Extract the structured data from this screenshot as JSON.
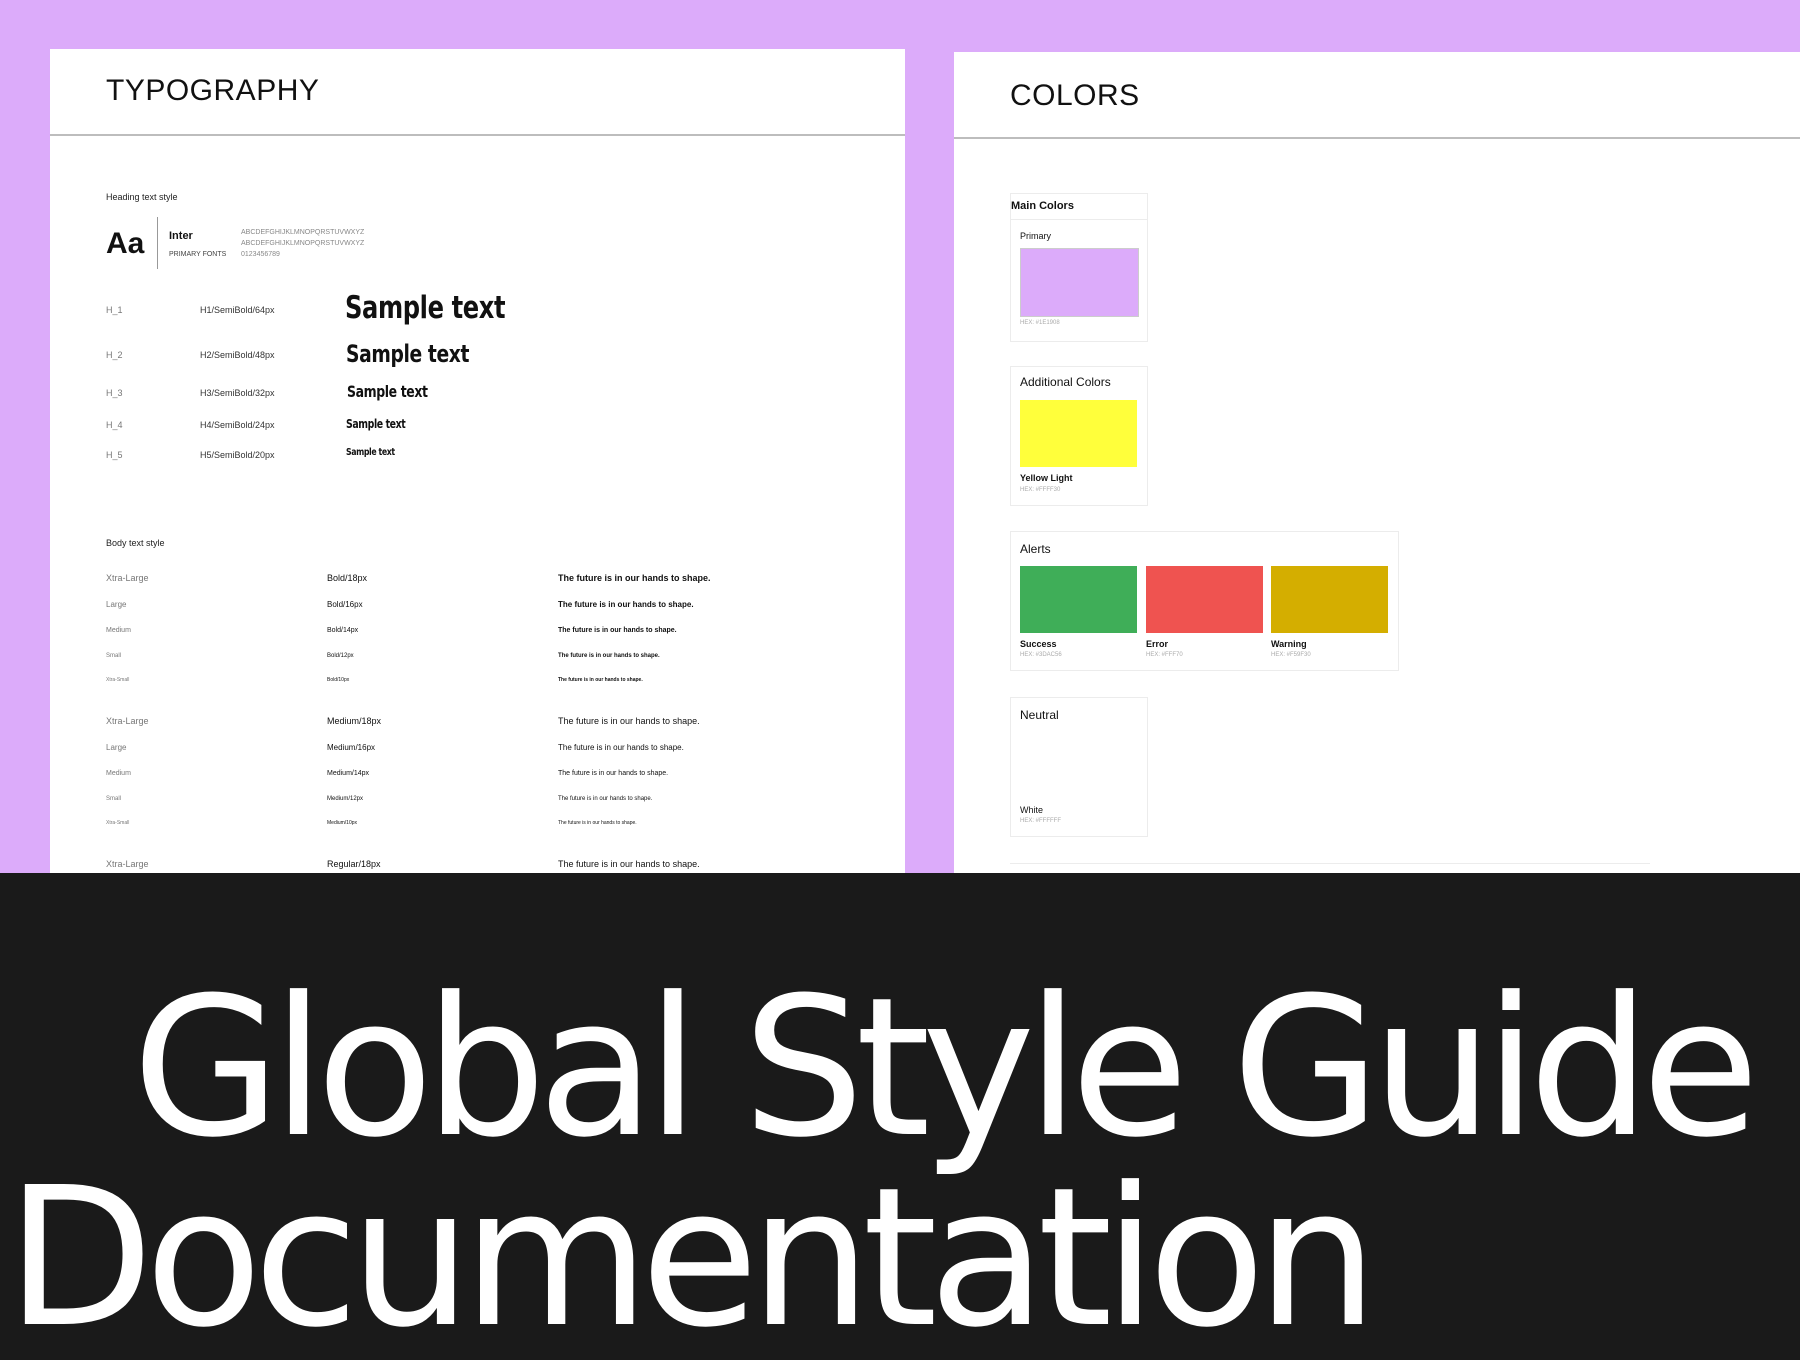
{
  "typography": {
    "title": "TYPOGRAPHY",
    "heading_section": "Heading text style",
    "font_preview": "Aa",
    "font_name": "Inter",
    "font_role": "PRIMARY FONTS",
    "charset_upper": "ABCDEFGHIJKLMNOPQRSTUVWXYZ",
    "charset_lower": "ABCDEFGHIJKLMNOPQRSTUVWXYZ",
    "charset_digits": "0123456789",
    "headings": [
      {
        "label": "H_1",
        "spec": "H1/SemiBold/64px",
        "sample": "Sample text"
      },
      {
        "label": "H_2",
        "spec": "H2/SemiBold/48px",
        "sample": "Sample text"
      },
      {
        "label": "H_3",
        "spec": "H3/SemiBold/32px",
        "sample": "Sample text"
      },
      {
        "label": "H_4",
        "spec": "H4/SemiBold/24px",
        "sample": "Sample text"
      },
      {
        "label": "H_5",
        "spec": "H5/SemiBold/20px",
        "sample": "Sample text"
      }
    ],
    "body_section": "Body text style",
    "body_groups": [
      [
        {
          "size": "Xtra-Large",
          "spec": "Bold/18px",
          "sample": "The future is in our hands to shape."
        },
        {
          "size": "Large",
          "spec": "Bold/16px",
          "sample": "The future is in our hands to shape."
        },
        {
          "size": "Medium",
          "spec": "Bold/14px",
          "sample": "The future is in our hands to shape."
        },
        {
          "size": "Small",
          "spec": "Bold/12px",
          "sample": "The future is in our hands to shape."
        },
        {
          "size": "Xtra-Small",
          "spec": "Bold/10px",
          "sample": "The future is in our hands to shape."
        }
      ],
      [
        {
          "size": "Xtra-Large",
          "spec": "Medium/18px",
          "sample": "The future is in our hands to shape."
        },
        {
          "size": "Large",
          "spec": "Medium/16px",
          "sample": "The future is in our hands to shape."
        },
        {
          "size": "Medium",
          "spec": "Medium/14px",
          "sample": "The future is in our hands to shape."
        },
        {
          "size": "Small",
          "spec": "Medium/12px",
          "sample": "The future is in our hands to shape."
        },
        {
          "size": "Xtra-Small",
          "spec": "Medium/10px",
          "sample": "The future is in our hands to shape."
        }
      ],
      [
        {
          "size": "Xtra-Large",
          "spec": "Regular/18px",
          "sample": "The future is in our hands to shape."
        }
      ]
    ]
  },
  "colors": {
    "title": "COLORS",
    "main": {
      "title": "Main Colors",
      "name": "Primary",
      "hex": "HEX: #1E1908",
      "color": "#dcabfa"
    },
    "additional": {
      "title": "Additional Colors",
      "name": "Yellow Light",
      "hex": "HEX: #FFFF30",
      "color": "#ffff3b"
    },
    "alerts": {
      "title": "Alerts",
      "items": [
        {
          "name": "Success",
          "hex": "HEX: #3DAC56",
          "color": "#3fae58"
        },
        {
          "name": "Error",
          "hex": "HEX: #FFF70",
          "color": "#ef5350"
        },
        {
          "name": "Warning",
          "hex": "HEX: #F59F30",
          "color": "#d4ae00"
        }
      ]
    },
    "neutral": {
      "title": "Neutral",
      "name": "White",
      "hex": "HEX: #FFFFFF",
      "color": "#ffffff"
    }
  },
  "banner": {
    "line1": "Global Style Guide",
    "line2": "Documentation"
  }
}
